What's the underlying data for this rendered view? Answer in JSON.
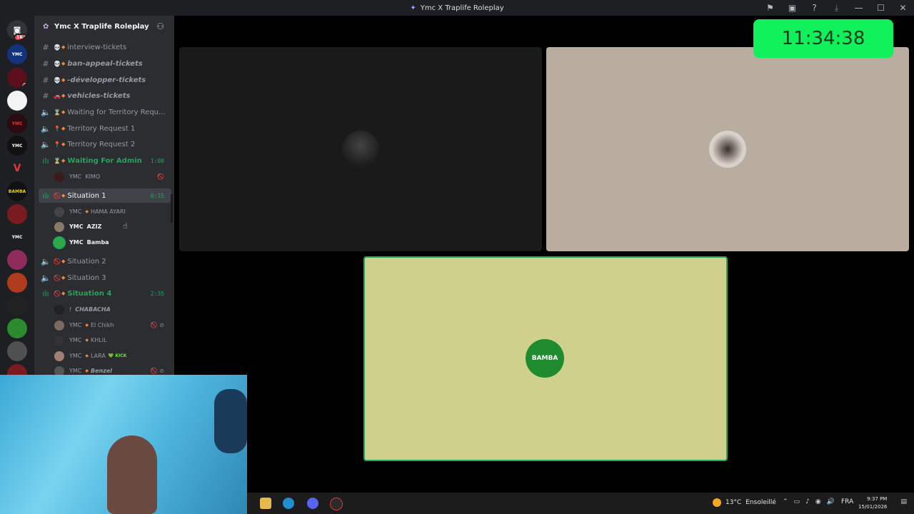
{
  "window": {
    "title": "Ymc X Traplife Roleplay"
  },
  "server": {
    "name": "Ymc X Traplife Roleplay"
  },
  "rail": [
    {
      "name": "home-icon",
      "badge": "1K+"
    },
    {
      "name": "server-1",
      "badge": "",
      "text": "YMC"
    },
    {
      "name": "server-2",
      "badge": "2",
      "text": ""
    },
    {
      "name": "server-3",
      "badge": "",
      "text": ""
    },
    {
      "name": "server-4",
      "badge": "",
      "text": "YMC"
    },
    {
      "name": "server-5",
      "badge": "",
      "text": "YMC"
    },
    {
      "name": "server-6",
      "badge": "",
      "text": "V"
    },
    {
      "name": "server-7",
      "badge": "",
      "text": "BAMBA"
    },
    {
      "name": "server-8",
      "badge": "",
      "text": ""
    },
    {
      "name": "server-9",
      "badge": "",
      "text": "YMC"
    },
    {
      "name": "server-10",
      "badge": "",
      "text": ""
    },
    {
      "name": "server-11",
      "badge": "",
      "text": ""
    },
    {
      "name": "server-12",
      "badge": "",
      "text": ""
    },
    {
      "name": "server-13",
      "badge": "",
      "text": ""
    },
    {
      "name": "server-14",
      "badge": "",
      "text": ""
    }
  ],
  "channels": [
    {
      "type": "text",
      "emoji": "💀",
      "label": "interview-tickets",
      "italic": false
    },
    {
      "type": "text",
      "emoji": "💀",
      "label": "ban-appeal-tickets",
      "italic": true
    },
    {
      "type": "text",
      "emoji": "💀",
      "label": "-développer-tickets",
      "italic": true
    },
    {
      "type": "text",
      "emoji": "🚗",
      "label": "vehicles-tickets",
      "italic": true
    },
    {
      "type": "voice",
      "emoji": "⏳",
      "label": "Waiting for Territory Requ..."
    },
    {
      "type": "voice",
      "emoji": "📍",
      "label": "Territory Request 1"
    },
    {
      "type": "voice",
      "emoji": "📍",
      "label": "Territory Request 2"
    },
    {
      "type": "voice-active",
      "emoji": "⏳",
      "label": "Waiting For Admin",
      "time": "1:00"
    },
    {
      "type": "voice-selected",
      "emoji": "🚫",
      "label": "Situation 1",
      "time": "0:15"
    },
    {
      "type": "voice",
      "emoji": "🚫",
      "label": "Situation 2"
    },
    {
      "type": "voice",
      "emoji": "🚫",
      "label": "Situation 3"
    },
    {
      "type": "voice-active",
      "emoji": "🚫",
      "label": "Situation 4",
      "time": "2:35"
    }
  ],
  "users_waiting": [
    {
      "tag": "YMC",
      "name": "KIMO",
      "flags": "🚫"
    }
  ],
  "users_situation1": [
    {
      "tag": "YMC",
      "name": "HAMA AYARI",
      "bright": false
    },
    {
      "tag": "YMC",
      "name": "AZIZ",
      "bright": true
    },
    {
      "tag": "YMC",
      "name": "Bamba",
      "bright": true
    }
  ],
  "users_situation4": [
    {
      "tag": "!",
      "name": "CHABACHA",
      "flags": ""
    },
    {
      "tag": "YMC",
      "name": "El Chikh",
      "flags": "🚫 ⊘"
    },
    {
      "tag": "YMC",
      "name": "KHLIL",
      "flags": ""
    },
    {
      "tag": "YMC",
      "name": "LARA",
      "extra": "KICK",
      "flags": ""
    },
    {
      "tag": "YMC",
      "name": "Benzel",
      "flags": "🚫 ⊘"
    }
  ],
  "clock": "11:34:38",
  "tiles": [
    {
      "name": "video-tile-1",
      "bg": "#1a1a1a"
    },
    {
      "name": "video-tile-2",
      "bg": "#b9ada0"
    },
    {
      "name": "video-tile-bamba",
      "bg": "#cfd08c",
      "avatar_text": "BAMBA"
    }
  ],
  "taskbar": {
    "temperature": "13°C",
    "weather": "Ensoleillé",
    "language": "FRA",
    "time": "9:37 PM",
    "date": "15/01/2026"
  },
  "colors": {
    "sidebar": "#2b2d31",
    "rail": "#1e1f22",
    "active_green": "#23a55a",
    "clock_green": "#10f05a",
    "diamond_orange": "#f0883e"
  }
}
